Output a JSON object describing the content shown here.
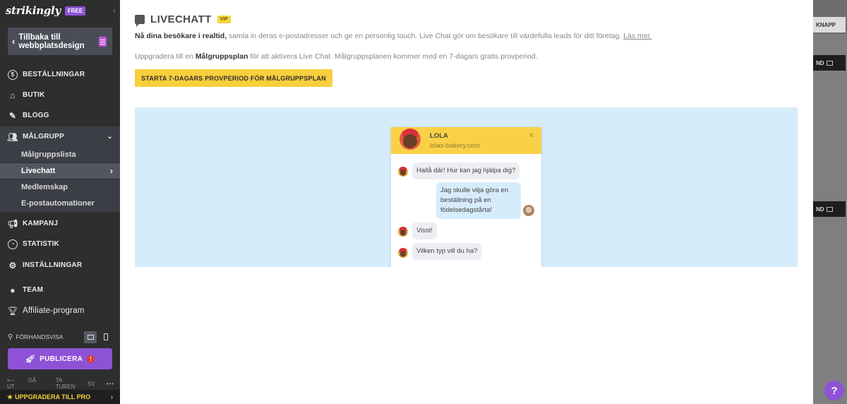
{
  "sidebar": {
    "logo": "strikingly",
    "plan_badge": "FREE",
    "back_button": "Tillbaka till webbplatsdesign",
    "nav": [
      {
        "label": "BESTÄLLNINGAR",
        "icon": "dollar-circle-icon"
      },
      {
        "label": "BUTIK",
        "icon": "store-icon"
      },
      {
        "label": "BLOGG",
        "icon": "pen-icon"
      },
      {
        "label": "MÅLGRUPP",
        "icon": "audience-icon"
      },
      {
        "label": "KAMPANJ",
        "icon": "megaphone-icon"
      },
      {
        "label": "STATISTIK",
        "icon": "chart-icon"
      },
      {
        "label": "INSTÄLLNINGAR",
        "icon": "gear-icon"
      }
    ],
    "sub_nav": [
      "Målgruppslista",
      "Livechatt",
      "Medlemskap",
      "E-postautomationer"
    ],
    "team": "TEAM",
    "affiliate": "Affiliate-program",
    "preview_label": "FÖRHANDSVISA",
    "publish": "PUBLICERA",
    "bottom_links": [
      "GÅ UT",
      "TA TUREN",
      "SV"
    ],
    "upgrade": "UPPGRADERA TILL PRO"
  },
  "main": {
    "title": "LIVECHATT",
    "vip_badge": "VIP",
    "desc_bold": "Nå dina besökare i realtid,",
    "desc_rest": " samla in deras e-postadresser och ge en personlig touch. Live Chat gör om besökare till värdefulla leads för ditt företag. ",
    "learn_more": "Läs mer.",
    "upgrade_pre": "Uppgradera till en ",
    "upgrade_bold": "Målgruppsplan",
    "upgrade_post": " för att aktivera Live Chat. Målgruppsplanen kommer med en 7-dagars gratis provperiod.",
    "trial_button": "STARTA 7-DAGARS PROVPERIOD FÖR MÅLGRUPPSPLAN"
  },
  "chat_preview": {
    "name": "LOLA",
    "site": "lolas-bakery.com",
    "messages": [
      {
        "from": "agent",
        "text": "Hallå där! Hur kan jag hjälpa dig?"
      },
      {
        "from": "user",
        "lines": [
          "Jag skulle vilja göra en",
          "beställning på en",
          "födelsedagstårta!"
        ]
      },
      {
        "from": "agent",
        "text": "Visst!"
      },
      {
        "from": "agent",
        "text": "Vilken typ vill du ha?"
      }
    ]
  },
  "right_panel": {
    "buttons": [
      "KNAPP",
      "ND",
      "ND"
    ]
  },
  "help": "?"
}
